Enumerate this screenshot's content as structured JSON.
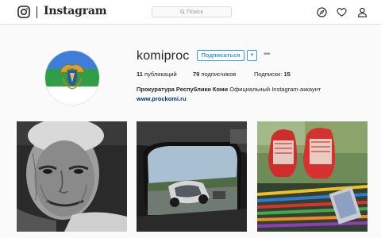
{
  "header": {
    "brand": "Instagram",
    "search_placeholder": "Поиск",
    "icons": [
      "instagram-logo-icon",
      "search-icon",
      "compass-icon",
      "heart-icon",
      "person-icon"
    ]
  },
  "profile": {
    "username": "komiproc",
    "subscribe_label": "Подписаться",
    "dropdown_symbol": "▾",
    "more_symbol": "•••",
    "stats": {
      "posts_count": "11",
      "posts_label": "публикаций",
      "followers_count": "79",
      "followers_label": "подписчиков",
      "following_label": "Подписки:",
      "following_count": "15"
    },
    "full_name": "Прокуратура Республики Коми",
    "bio": "Официальный Instagram-аккаунт",
    "website": "www.prockomi.ru"
  },
  "colors": {
    "accent": "#3897f0",
    "link": "#003569",
    "text": "#262626",
    "background": "#fafafa",
    "flag_white": "#ffffff",
    "flag_green": "#2f9e44",
    "flag_blue": "#3f7ed8"
  },
  "posts": [
    {
      "subject": "elderly-woman-portrait"
    },
    {
      "subject": "car-crash-in-side-mirror"
    },
    {
      "subject": "red-sneakers-and-pencils"
    }
  ]
}
